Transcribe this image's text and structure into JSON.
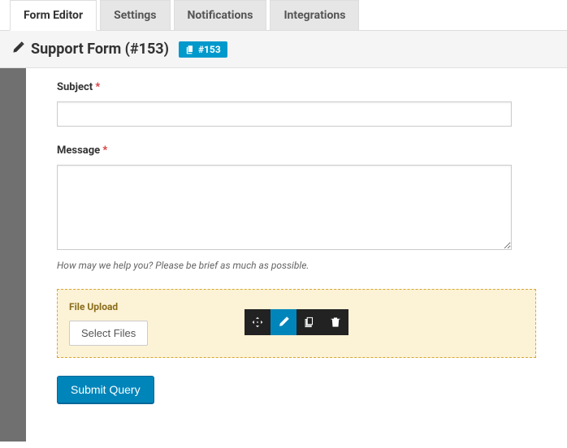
{
  "tabs": {
    "form_editor": "Form Editor",
    "settings": "Settings",
    "notifications": "Notifications",
    "integrations": "Integrations"
  },
  "header": {
    "title": "Support Form (#153)",
    "shortcode": "#153"
  },
  "fields": {
    "subject": {
      "label": "Subject",
      "value": ""
    },
    "message": {
      "label": "Message",
      "value": "",
      "help": "How may we help you? Please be brief as much as possible."
    },
    "file_upload": {
      "label": "File Upload",
      "button": "Select Files"
    }
  },
  "submit": {
    "label": "Submit Query"
  }
}
